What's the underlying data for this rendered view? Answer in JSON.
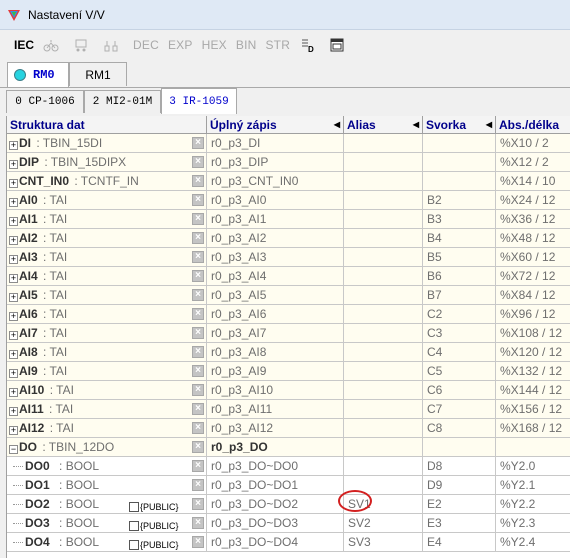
{
  "window": {
    "title": "Nastavení V/V"
  },
  "toolbar": {
    "items": [
      {
        "label": "IEC",
        "enabled": true
      },
      {
        "label": "DEC",
        "enabled": false
      },
      {
        "label": "EXP",
        "enabled": false
      },
      {
        "label": "HEX",
        "enabled": false
      },
      {
        "label": "BIN",
        "enabled": false
      },
      {
        "label": "STR",
        "enabled": false
      }
    ]
  },
  "rm_tabs": [
    {
      "label": "RM0",
      "selected": true
    },
    {
      "label": "RM1",
      "selected": false
    }
  ],
  "module_tabs": [
    {
      "label": "0 CP-1006",
      "selected": false
    },
    {
      "label": "2 MI2-01M",
      "selected": false
    },
    {
      "label": "3 IR-1059",
      "selected": true
    }
  ],
  "grid": {
    "columns": [
      "Struktura dat",
      "Úplný zápis",
      "Alias",
      "Svorka",
      "Abs./délka"
    ],
    "rows": [
      {
        "expander": "+",
        "name": "DI",
        "type": ": TBIN_15DI",
        "full": "r0_p3_DI",
        "alias": "",
        "svorka": "",
        "abs": "%X10 / 2"
      },
      {
        "expander": "+",
        "name": "DIP",
        "type": ": TBIN_15DIPX",
        "full": "r0_p3_DIP",
        "alias": "",
        "svorka": "",
        "abs": "%X12 / 2"
      },
      {
        "expander": "+",
        "name": "CNT_IN0",
        "type": ": TCNTF_IN",
        "full": "r0_p3_CNT_IN0",
        "alias": "",
        "svorka": "",
        "abs": "%X14 / 10"
      },
      {
        "expander": "+",
        "name": "AI0",
        "type": ": TAI",
        "full": "r0_p3_AI0",
        "alias": "",
        "svorka": "B2",
        "abs": "%X24 / 12"
      },
      {
        "expander": "+",
        "name": "AI1",
        "type": ": TAI",
        "full": "r0_p3_AI1",
        "alias": "",
        "svorka": "B3",
        "abs": "%X36 / 12"
      },
      {
        "expander": "+",
        "name": "AI2",
        "type": ": TAI",
        "full": "r0_p3_AI2",
        "alias": "",
        "svorka": "B4",
        "abs": "%X48 / 12"
      },
      {
        "expander": "+",
        "name": "AI3",
        "type": ": TAI",
        "full": "r0_p3_AI3",
        "alias": "",
        "svorka": "B5",
        "abs": "%X60 / 12"
      },
      {
        "expander": "+",
        "name": "AI4",
        "type": ": TAI",
        "full": "r0_p3_AI4",
        "alias": "",
        "svorka": "B6",
        "abs": "%X72 / 12"
      },
      {
        "expander": "+",
        "name": "AI5",
        "type": ": TAI",
        "full": "r0_p3_AI5",
        "alias": "",
        "svorka": "B7",
        "abs": "%X84 / 12"
      },
      {
        "expander": "+",
        "name": "AI6",
        "type": ": TAI",
        "full": "r0_p3_AI6",
        "alias": "",
        "svorka": "C2",
        "abs": "%X96 / 12"
      },
      {
        "expander": "+",
        "name": "AI7",
        "type": ": TAI",
        "full": "r0_p3_AI7",
        "alias": "",
        "svorka": "C3",
        "abs": "%X108 / 12"
      },
      {
        "expander": "+",
        "name": "AI8",
        "type": ": TAI",
        "full": "r0_p3_AI8",
        "alias": "",
        "svorka": "C4",
        "abs": "%X120 / 12"
      },
      {
        "expander": "+",
        "name": "AI9",
        "type": ": TAI",
        "full": "r0_p3_AI9",
        "alias": "",
        "svorka": "C5",
        "abs": "%X132 / 12"
      },
      {
        "expander": "+",
        "name": "AI10",
        "type": ": TAI",
        "full": "r0_p3_AI10",
        "alias": "",
        "svorka": "C6",
        "abs": "%X144 / 12"
      },
      {
        "expander": "+",
        "name": "AI11",
        "type": ": TAI",
        "full": "r0_p3_AI11",
        "alias": "",
        "svorka": "C7",
        "abs": "%X156 / 12"
      },
      {
        "expander": "+",
        "name": "AI12",
        "type": ": TAI",
        "full": "r0_p3_AI12",
        "alias": "",
        "svorka": "C8",
        "abs": "%X168 / 12"
      },
      {
        "expander": "−",
        "name": "DO",
        "type": ": TBIN_12DO",
        "full": "r0_p3_DO",
        "alias": "",
        "svorka": "",
        "abs": "",
        "group": true
      },
      {
        "expander": "",
        "name": "DO0",
        "type": ": BOOL",
        "full": "r0_p3_DO~DO0",
        "alias": "",
        "svorka": "D8",
        "abs": "%Y2.0",
        "sub": true
      },
      {
        "expander": "",
        "name": "DO1",
        "type": ": BOOL",
        "full": "r0_p3_DO~DO1",
        "alias": "",
        "svorka": "D9",
        "abs": "%Y2.1",
        "sub": true
      },
      {
        "expander": "",
        "name": "DO2",
        "type": ": BOOL",
        "full": "r0_p3_DO~DO2",
        "alias": "SV1",
        "svorka": "E2",
        "abs": "%Y2.2",
        "sub": true,
        "public": "{PUBLIC}"
      },
      {
        "expander": "",
        "name": "DO3",
        "type": ": BOOL",
        "full": "r0_p3_DO~DO3",
        "alias": "SV2",
        "svorka": "E3",
        "abs": "%Y2.3",
        "sub": true,
        "public": "{PUBLIC}"
      },
      {
        "expander": "",
        "name": "DO4",
        "type": ": BOOL",
        "full": "r0_p3_DO~DO4",
        "alias": "SV3",
        "svorka": "E4",
        "abs": "%Y2.4",
        "sub": true,
        "public": "{PUBLIC}"
      }
    ]
  }
}
